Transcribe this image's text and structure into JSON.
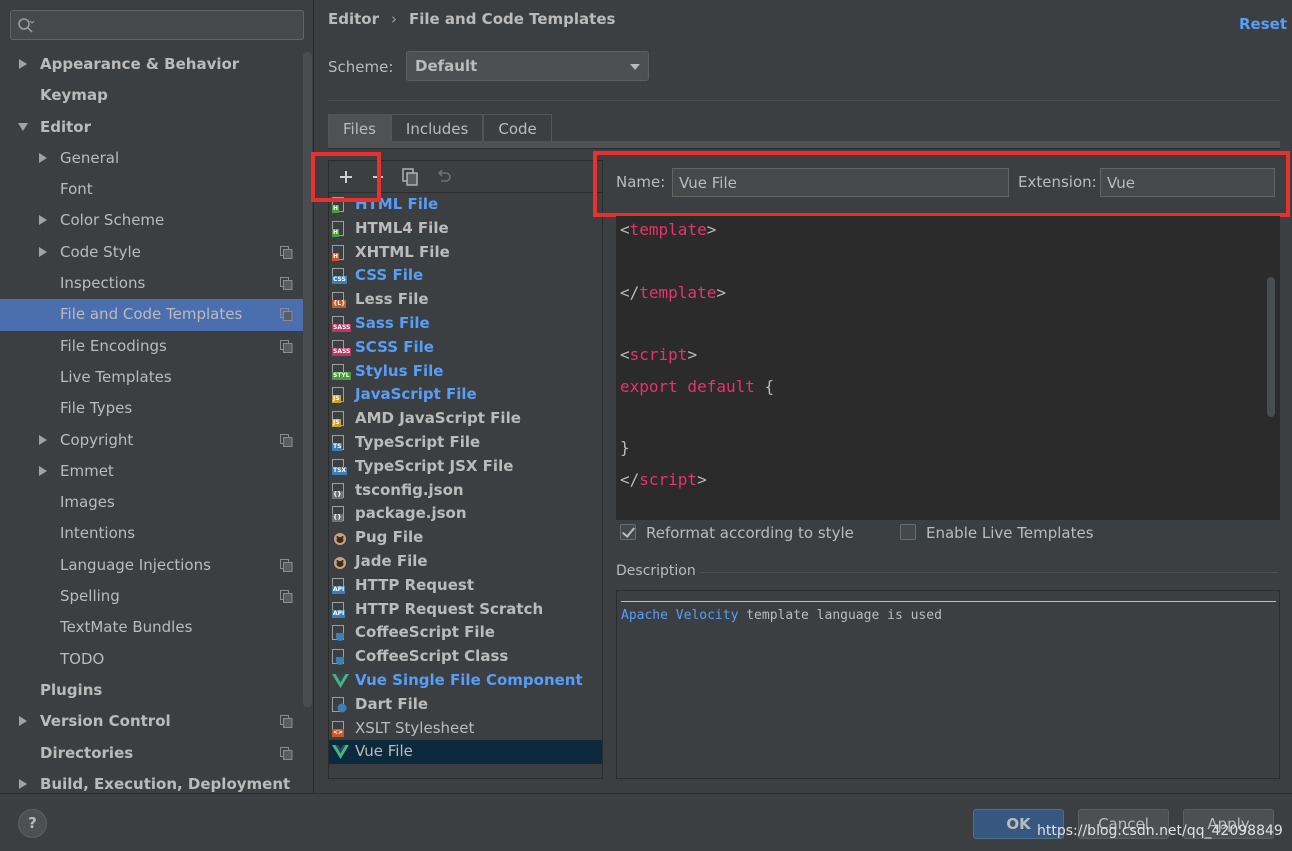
{
  "sidebar": {
    "search_placeholder": "",
    "items": [
      {
        "label": "Appearance & Behavior",
        "level": 0,
        "bold": true,
        "arrow": "right"
      },
      {
        "label": "Keymap",
        "level": 0,
        "bold": true,
        "arrow": ""
      },
      {
        "label": "Editor",
        "level": 0,
        "bold": true,
        "arrow": "down"
      },
      {
        "label": "General",
        "level": 1,
        "arrow": "right"
      },
      {
        "label": "Font",
        "level": 1,
        "arrow": ""
      },
      {
        "label": "Color Scheme",
        "level": 1,
        "arrow": "right"
      },
      {
        "label": "Code Style",
        "level": 1,
        "arrow": "right",
        "copy": true
      },
      {
        "label": "Inspections",
        "level": 1,
        "arrow": "",
        "copy": true
      },
      {
        "label": "File and Code Templates",
        "level": 1,
        "arrow": "",
        "copy": true,
        "selected": true
      },
      {
        "label": "File Encodings",
        "level": 1,
        "arrow": "",
        "copy": true
      },
      {
        "label": "Live Templates",
        "level": 1,
        "arrow": ""
      },
      {
        "label": "File Types",
        "level": 1,
        "arrow": ""
      },
      {
        "label": "Copyright",
        "level": 1,
        "arrow": "right",
        "copy": true
      },
      {
        "label": "Emmet",
        "level": 1,
        "arrow": "right"
      },
      {
        "label": "Images",
        "level": 1,
        "arrow": ""
      },
      {
        "label": "Intentions",
        "level": 1,
        "arrow": ""
      },
      {
        "label": "Language Injections",
        "level": 1,
        "arrow": "",
        "copy": true
      },
      {
        "label": "Spelling",
        "level": 1,
        "arrow": "",
        "copy": true
      },
      {
        "label": "TextMate Bundles",
        "level": 1,
        "arrow": ""
      },
      {
        "label": "TODO",
        "level": 1,
        "arrow": ""
      },
      {
        "label": "Plugins",
        "level": 0,
        "bold": true,
        "arrow": ""
      },
      {
        "label": "Version Control",
        "level": 0,
        "bold": true,
        "arrow": "right",
        "copy": true
      },
      {
        "label": "Directories",
        "level": 0,
        "bold": true,
        "arrow": "",
        "copy": true
      },
      {
        "label": "Build, Execution, Deployment",
        "level": 0,
        "bold": true,
        "arrow": "right"
      }
    ]
  },
  "header": {
    "crumb1": "Editor",
    "sep": "›",
    "crumb2": "File and Code Templates",
    "reset": "Reset"
  },
  "scheme": {
    "label": "Scheme:",
    "value": "Default"
  },
  "tabs": [
    "Files",
    "Includes",
    "Code"
  ],
  "files": [
    {
      "label": "HTML File",
      "icon": "H",
      "color": "#4a9a3e",
      "blue": true
    },
    {
      "label": "HTML4 File",
      "icon": "H",
      "color": "#4a9a3e"
    },
    {
      "label": "XHTML File",
      "icon": "H",
      "color": "#c75a2a"
    },
    {
      "label": "CSS File",
      "icon": "CSS",
      "color": "#3b7fb6",
      "blue": true
    },
    {
      "label": "Less File",
      "icon": "{L}",
      "color": "#c75a2a"
    },
    {
      "label": "Sass File",
      "icon": "SASS",
      "color": "#c0355f",
      "blue": true
    },
    {
      "label": "SCSS File",
      "icon": "SASS",
      "color": "#c0355f",
      "blue": true
    },
    {
      "label": "Stylus File",
      "icon": "STYL",
      "color": "#4a9a3e",
      "blue": true
    },
    {
      "label": "JavaScript File",
      "icon": "JS",
      "color": "#c9a227",
      "blue": true
    },
    {
      "label": "AMD JavaScript File",
      "icon": "JS",
      "color": "#c9a227"
    },
    {
      "label": "TypeScript File",
      "icon": "TS",
      "color": "#3b7fb6"
    },
    {
      "label": "TypeScript JSX File",
      "icon": "TSX",
      "color": "#3b7fb6"
    },
    {
      "label": "tsconfig.json",
      "icon": "{}",
      "color": "#6e7274"
    },
    {
      "label": "package.json",
      "icon": "{}",
      "color": "#6e7274"
    },
    {
      "label": "Pug File",
      "icon": "pug",
      "color": "#a86b45"
    },
    {
      "label": "Jade File",
      "icon": "pug",
      "color": "#a86b45"
    },
    {
      "label": "HTTP Request",
      "icon": "API",
      "color": "#3b7fb6"
    },
    {
      "label": "HTTP Request Scratch",
      "icon": "API",
      "color": "#3b7fb6"
    },
    {
      "label": "CoffeeScript File",
      "icon": "cup",
      "color": "#3b7fb6"
    },
    {
      "label": "CoffeeScript Class",
      "icon": "cup",
      "color": "#3b7fb6"
    },
    {
      "label": "Vue Single File Component",
      "icon": "vue",
      "color": "#41b883",
      "blue": true
    },
    {
      "label": "Dart File",
      "icon": "dart",
      "color": "#3b7fb6"
    },
    {
      "label": "XSLT Stylesheet",
      "icon": "<>",
      "color": "#c75a2a",
      "plain": true
    },
    {
      "label": "Vue File",
      "icon": "vue",
      "color": "#41b883",
      "plain": true,
      "selected": true
    }
  ],
  "editor": {
    "name_label": "Name:",
    "name_value": "Vue File",
    "ext_label": "Extension:",
    "ext_value": "Vue",
    "code": {
      "open_template": "template",
      "close_template": "template",
      "open_script": "script",
      "export_kw": "export default",
      "export_brace": "{",
      "close_brace": "}",
      "close_script": "script"
    },
    "reformat_label": "Reformat according to style",
    "reformat_checked": true,
    "live_label": "Enable Live Templates",
    "live_checked": false,
    "description_label": "Description",
    "description_link": "Apache Velocity",
    "description_text": " template language is used"
  },
  "buttons": {
    "help": "?",
    "ok": "OK",
    "cancel": "Cancel",
    "apply": "Apply"
  },
  "watermark": "https://blog.csdn.net/qq_42098849"
}
